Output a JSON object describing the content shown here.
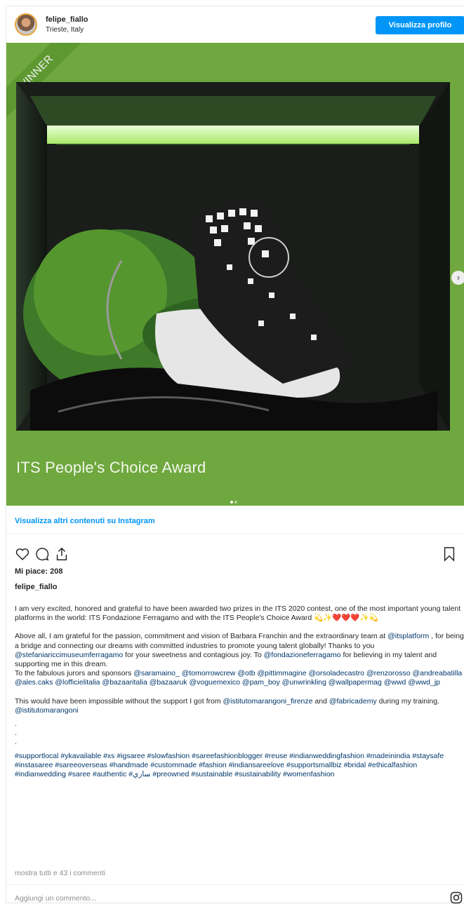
{
  "header": {
    "username": "felipe_fiallo",
    "location": "Trieste, Italy",
    "profile_button": "Visualizza profilo"
  },
  "media": {
    "ribbon": "WINNER",
    "overlay_title": "ITS People's Choice Award",
    "slide_count": 2,
    "current_slide": 1,
    "accent_color": "#6fa83e"
  },
  "more_link": "Visualizza altri contenuti su Instagram",
  "actions": {
    "icons": [
      "heart-icon",
      "comment-icon",
      "share-icon",
      "bookmark-icon"
    ]
  },
  "likes": "Mi piace: 208",
  "owner": "felipe_fiallo",
  "caption": {
    "p1": "I am very excited, honored and grateful to have been awarded two prizes in the ITS 2020 contest, one of the most important young talent platforms in the world: ITS Fondazione Ferragamo and with the ITS People's Choice Award 💫✨❤️❤️❤️✨💫",
    "p2_a": "Above all, I am grateful for the passion, commitment and vision of Barbara Franchin and the extraordinary team at ",
    "p2_tag1": "@itsplatform",
    "p2_b": " , for being a bridge and connecting our dreams with committed industries to promote young talent globally! Thanks to you ",
    "p2_tag2": "@stefaniariccimuseumferragamo",
    "p2_c": " for your sweetness and contagious joy. To ",
    "p2_tag3": "@fondazioneferragamo",
    "p2_d": " for believing in my talent and supporting me in this dream.",
    "p3_a": "To the fabulous jurors and sponsors ",
    "p3_tags": "@saramaino_ @tomorrowcrew @otb @pittimmagine @orsoladecastro @renzorosso @andreabatilla @ales.caks @lofficielitalia @bazaaritalia @bazaaruk @voguemexico @pam_boy @unwrinkling @wallpapermag @wwd @wwd_jp",
    "p4_a": "This would have been impossible without the support I got from ",
    "p4_tag1": "@istitutomarangoni_firenze",
    "p4_b": " and ",
    "p4_tag2": "@fabricademy",
    "p4_c": " during my training. ",
    "p4_tag3": "@istitutomarangoni",
    "dots": [
      ".",
      ".",
      "."
    ],
    "hashtags": "#supportlocal #ykavailable #xs #igsaree #slowfashion #sareefashionblogger #reuse #indianweddingfashion #madeinindia #staysafe #instasaree #sareeoverseas #handmade #custommade #fashion #indiansareelove #supportsmallbiz #bridal #ethicalfashion #indianwedding #saree #authentic #ساري #preowned #sustainable #sustainability #womenfashion"
  },
  "comments_link": "mostra tutti e 43 i commenti",
  "comment_placeholder": "Aggiungi un commento..."
}
